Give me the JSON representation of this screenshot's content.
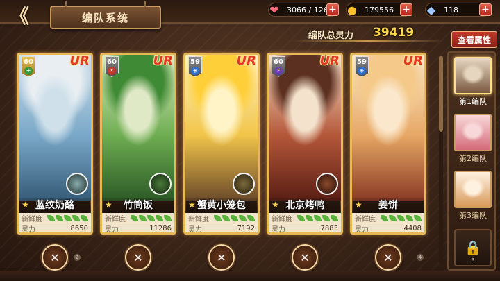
{
  "header": {
    "back_glyph": "《",
    "title": "编队系统"
  },
  "resources": {
    "heart": "3066 / 126",
    "coin": "179556",
    "gem": "118"
  },
  "power": {
    "label": "编队总灵力",
    "value": "39419",
    "view_button": "查看属性"
  },
  "cards": [
    {
      "name": "蓝纹奶酪",
      "level": "60",
      "rarity": "UR",
      "fresh_label": "新鲜度",
      "power_label": "灵力",
      "power": "8650",
      "leaves": 5,
      "colors": {
        "top": "#cfe0ea",
        "mid": "#7aa8c8",
        "bottom": "#355c78",
        "hair": "#e8eef2"
      }
    },
    {
      "name": "竹筒饭",
      "level": "60",
      "rarity": "UR",
      "fresh_label": "新鲜度",
      "power_label": "灵力",
      "power": "11286",
      "leaves": 5,
      "colors": {
        "top": "#dfe9c6",
        "mid": "#6fae52",
        "bottom": "#2c5a26",
        "hair": "#3f8a34"
      }
    },
    {
      "name": "蟹黄小笼包",
      "level": "59",
      "rarity": "UR",
      "fresh_label": "新鲜度",
      "power_label": "灵力",
      "power": "7192",
      "leaves": 5,
      "colors": {
        "top": "#fff4c8",
        "mid": "#f2c54a",
        "bottom": "#6b4a2a",
        "hair": "#ffcf3a"
      }
    },
    {
      "name": "北京烤鸭",
      "level": "60",
      "rarity": "UR",
      "fresh_label": "新鲜度",
      "power_label": "灵力",
      "power": "7883",
      "leaves": 5,
      "colors": {
        "top": "#f4e2cc",
        "mid": "#b5583a",
        "bottom": "#5a1e14",
        "hair": "#5b3020"
      }
    },
    {
      "name": "姜饼",
      "level": "59",
      "rarity": "UR",
      "fresh_label": "新鲜度",
      "power_label": "灵力",
      "power": "4408",
      "leaves": 5,
      "colors": {
        "top": "#fbe8cc",
        "mid": "#e7a865",
        "bottom": "#8a3a24",
        "hair": "#f4c98a"
      }
    }
  ],
  "teams": [
    {
      "label": "第1编队",
      "active": true,
      "colors": {
        "top": "#e6d6c0",
        "bottom": "#7a5a40"
      }
    },
    {
      "label": "第2编队",
      "active": false,
      "colors": {
        "top": "#f8d8d8",
        "bottom": "#d46a7a"
      }
    },
    {
      "label": "第3编队",
      "active": false,
      "colors": {
        "top": "#fff1e0",
        "bottom": "#d89a5a"
      }
    }
  ],
  "lock_slot": {
    "count": "3"
  },
  "card_dots": [
    "2",
    "",
    "",
    "",
    "4"
  ],
  "accent": "#e8b756"
}
